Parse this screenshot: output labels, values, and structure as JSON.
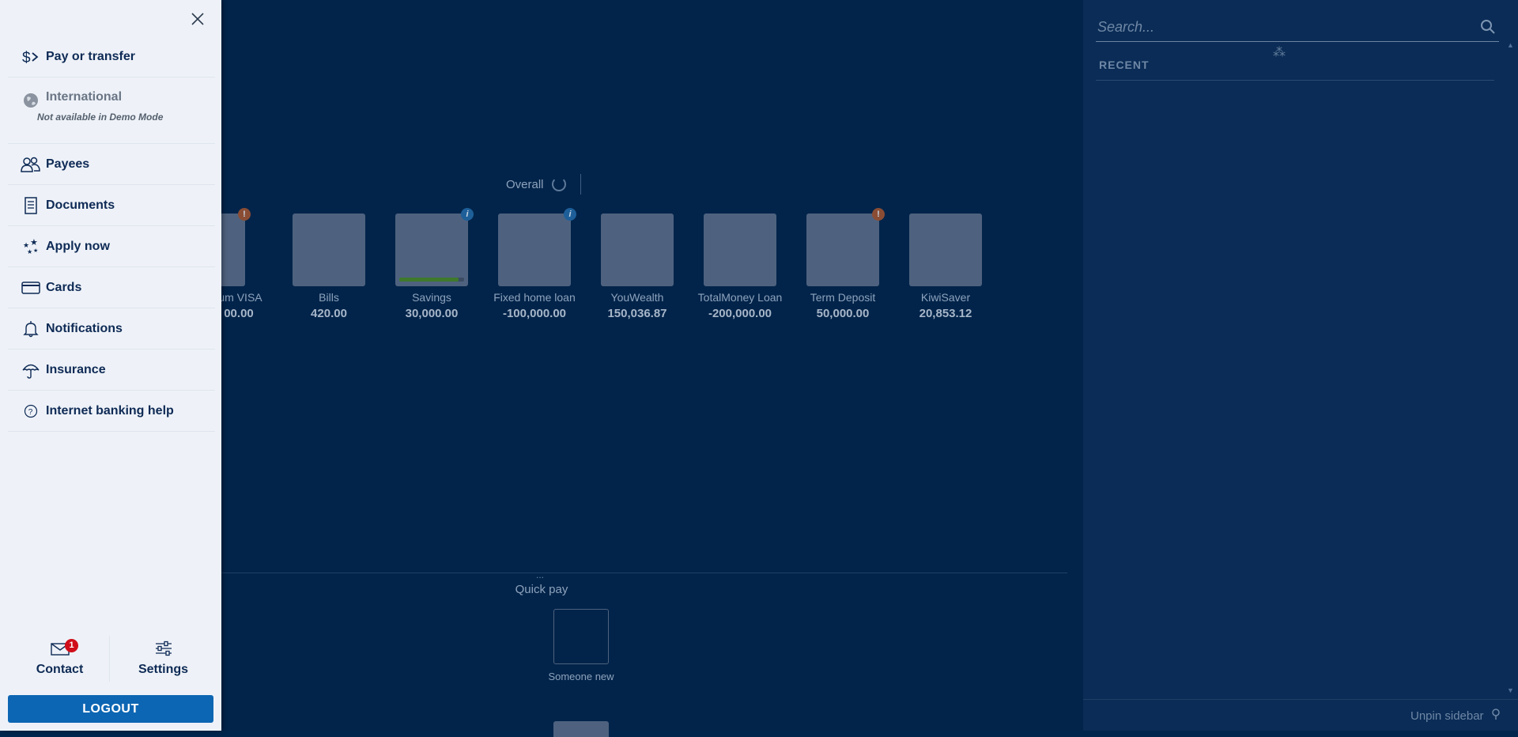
{
  "menu": {
    "items": [
      {
        "key": "pay",
        "label": "Pay or transfer"
      },
      {
        "key": "international",
        "label": "International",
        "sublabel": "Not available in Demo Mode"
      },
      {
        "key": "payees",
        "label": "Payees"
      },
      {
        "key": "documents",
        "label": "Documents"
      },
      {
        "key": "apply",
        "label": "Apply now"
      },
      {
        "key": "cards",
        "label": "Cards"
      },
      {
        "key": "notifications",
        "label": "Notifications"
      },
      {
        "key": "insurance",
        "label": "Insurance"
      },
      {
        "key": "help",
        "label": "Internet banking help"
      }
    ],
    "contact_label": "Contact",
    "contact_badge": "1",
    "settings_label": "Settings",
    "logout_label": "LOGOUT"
  },
  "dashboard": {
    "overall_label": "Overall",
    "accounts": [
      {
        "name": "um VISA",
        "amount": "00.00",
        "badge": "!"
      },
      {
        "name": "Bills",
        "amount": "420.00"
      },
      {
        "name": "Savings",
        "amount": "30,000.00",
        "badge": "i",
        "progress": 0.92
      },
      {
        "name": "Fixed home loan",
        "amount": "-100,000.00",
        "badge": "i"
      },
      {
        "name": "YouWealth",
        "amount": "150,036.87"
      },
      {
        "name": "TotalMoney Loan",
        "amount": "-200,000.00"
      },
      {
        "name": "Term Deposit",
        "amount": "50,000.00",
        "badge": "!"
      },
      {
        "name": "KiwiSaver",
        "amount": "20,853.12"
      }
    ],
    "quick_pay_label": "Quick pay",
    "quick_pay_dots": "...",
    "someone_new_label": "Someone new"
  },
  "sidebar": {
    "search_placeholder": "Search...",
    "recent_label": "RECENT",
    "unpin_label": "Unpin sidebar"
  },
  "colors": {
    "menu_bg": "#eef2f8",
    "logout_bg": "#0d66b3",
    "badge_red": "#d00e1a",
    "backdrop": "#02244a"
  }
}
